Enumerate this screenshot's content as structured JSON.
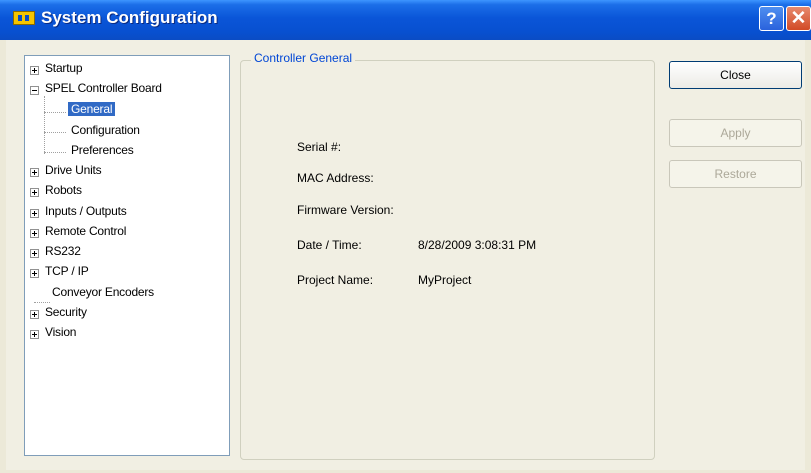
{
  "window": {
    "title": "System Configuration",
    "help_glyph": "?",
    "close_glyph": "✕"
  },
  "tree": {
    "items": [
      {
        "label": "Startup",
        "expander": "plus"
      },
      {
        "label": "SPEL Controller Board",
        "expander": "minus"
      },
      {
        "label": "General",
        "selected": true
      },
      {
        "label": "Configuration"
      },
      {
        "label": "Preferences"
      },
      {
        "label": "Drive Units",
        "expander": "plus"
      },
      {
        "label": "Robots",
        "expander": "plus"
      },
      {
        "label": "Inputs / Outputs",
        "expander": "plus"
      },
      {
        "label": "Remote Control",
        "expander": "plus"
      },
      {
        "label": "RS232",
        "expander": "plus"
      },
      {
        "label": "TCP / IP",
        "expander": "plus"
      },
      {
        "label": "Conveyor Encoders"
      },
      {
        "label": "Security",
        "expander": "plus"
      },
      {
        "label": "Vision",
        "expander": "plus"
      }
    ]
  },
  "panel": {
    "title": "Controller General",
    "fields": [
      {
        "label": "Serial #:",
        "value": ""
      },
      {
        "label": "MAC Address:",
        "value": ""
      },
      {
        "label": "Firmware Version:",
        "value": ""
      },
      {
        "label": "Date / Time:",
        "value": "8/28/2009 3:08:31 PM"
      },
      {
        "label": "Project Name:",
        "value": "MyProject"
      }
    ]
  },
  "buttons": {
    "close": "Close",
    "apply": "Apply",
    "restore": "Restore"
  }
}
